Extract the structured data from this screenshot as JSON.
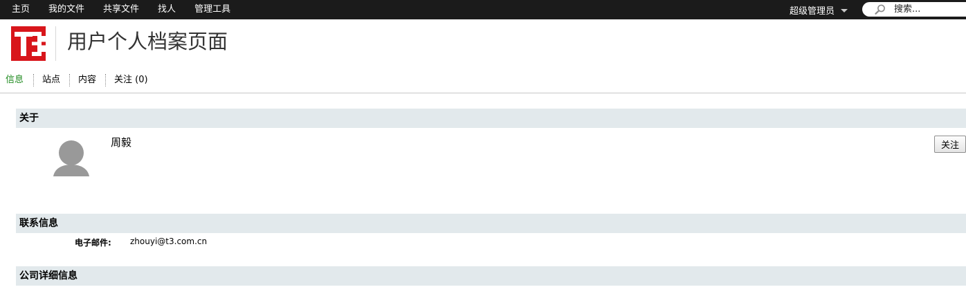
{
  "topnav": {
    "items": [
      {
        "label": "主页"
      },
      {
        "label": "我的文件"
      },
      {
        "label": "共享文件"
      },
      {
        "label": "找人"
      },
      {
        "label": "管理工具"
      }
    ],
    "user_label": "超级管理员",
    "search_placeholder": "搜索..."
  },
  "header": {
    "logo_text": "T3",
    "title": "用户个人档案页面"
  },
  "tabs": [
    {
      "label": "信息",
      "active": true
    },
    {
      "label": "站点"
    },
    {
      "label": "内容"
    },
    {
      "label": "关注 (0)"
    }
  ],
  "about": {
    "heading": "关于",
    "name": "周毅",
    "follow_label": "关注"
  },
  "contact": {
    "heading": "联系信息",
    "email_label": "电子邮件:",
    "email": "zhouyi@t3.com.cn"
  },
  "company": {
    "heading": "公司详细信息"
  },
  "colors": {
    "topbar": "#1b1b1b",
    "logo_red": "#d8161b",
    "active_tab": "#1f8a1f",
    "section_bg": "#e2e9ec"
  }
}
